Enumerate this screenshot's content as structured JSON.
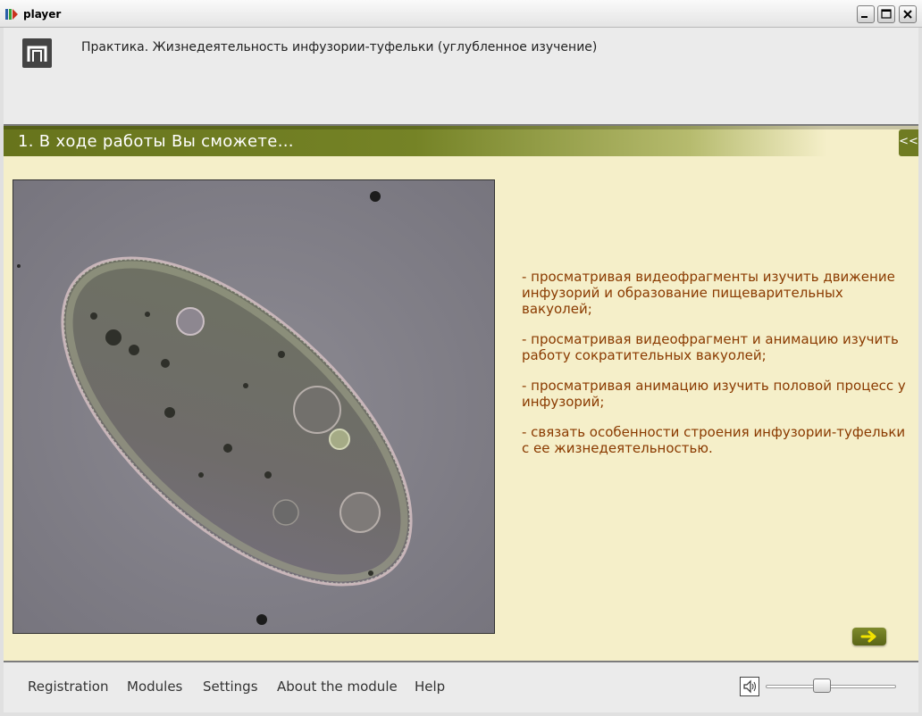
{
  "window": {
    "title": "player",
    "controls": {
      "minimize_icon": "minimize-icon",
      "maximize_icon": "maximize-icon",
      "close_icon": "close-icon"
    }
  },
  "header": {
    "logo_icon": "pi-logo-icon",
    "title": "Практика. Жизнедеятельность инфузории-туфельки (углубленное изучение)"
  },
  "section": {
    "title": "1. В ходе работы Вы сможете…",
    "collapse_label": "<<"
  },
  "content": {
    "image": "paramecium-microscope-photo",
    "bullets": [
      "- просматривая видеофрагменты изучить движение инфузорий и образование пищеварительных вакуолей;",
      "- просматривая видеофрагмент и анимацию изучить работу сократительных вакуолей;",
      "- просматривая анимацию изучить половой процесс у инфузорий;",
      "- связать особенности строения инфузории-туфельки с ее жизнедеятельностью."
    ],
    "next_icon": "arrow-right-icon"
  },
  "footer": {
    "nav": [
      "Registration",
      "Modules",
      "Settings",
      "About the module",
      "Help"
    ],
    "volume_icon": "speaker-icon",
    "volume_level": 0.42
  },
  "colors": {
    "accent_olive": "#6f7b22",
    "content_bg": "#f5efc9",
    "bullet_text": "#8a3a00"
  }
}
